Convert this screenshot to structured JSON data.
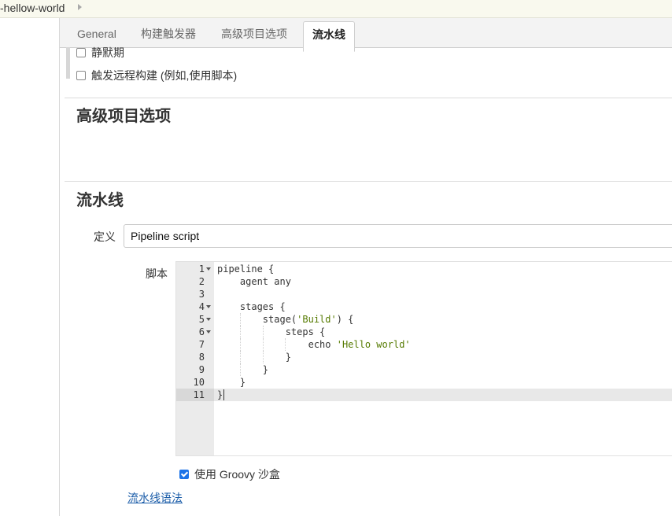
{
  "breadcrumb": {
    "item": "-hellow-world"
  },
  "tabs": [
    {
      "label": "General"
    },
    {
      "label": "构建触发器"
    },
    {
      "label": "高级项目选项"
    },
    {
      "label": "流水线",
      "active": true
    }
  ],
  "triggers": {
    "quiet_period": {
      "label": "静默期",
      "checked": false
    },
    "remote_build": {
      "label": "触发远程构建 (例如,使用脚本)",
      "checked": false
    }
  },
  "advanced": {
    "title": "高级项目选项"
  },
  "pipeline": {
    "title": "流水线",
    "definition_label": "定义",
    "definition_value": "Pipeline script",
    "script_label": "脚本",
    "code": {
      "lines": [
        {
          "num": "1",
          "fold": true,
          "text": "pipeline {"
        },
        {
          "num": "2",
          "fold": false,
          "text": "    agent any"
        },
        {
          "num": "3",
          "fold": false,
          "text": ""
        },
        {
          "num": "4",
          "fold": true,
          "text": "    stages {"
        },
        {
          "num": "5",
          "fold": true,
          "text": "        stage('Build') {"
        },
        {
          "num": "6",
          "fold": true,
          "text": "            steps {"
        },
        {
          "num": "7",
          "fold": false,
          "text": "                echo 'Hello world'"
        },
        {
          "num": "8",
          "fold": false,
          "text": "            }"
        },
        {
          "num": "9",
          "fold": false,
          "text": "        }"
        },
        {
          "num": "10",
          "fold": false,
          "text": "    }"
        },
        {
          "num": "11",
          "fold": false,
          "text": "}"
        }
      ],
      "active_line": 11
    },
    "groovy_sandbox": {
      "label": "使用 Groovy 沙盒",
      "checked": true
    },
    "syntax_link": "流水线语法"
  },
  "colors": {
    "accent": "#1b73e8",
    "link": "#1a5ca8",
    "string": "#557a00"
  }
}
